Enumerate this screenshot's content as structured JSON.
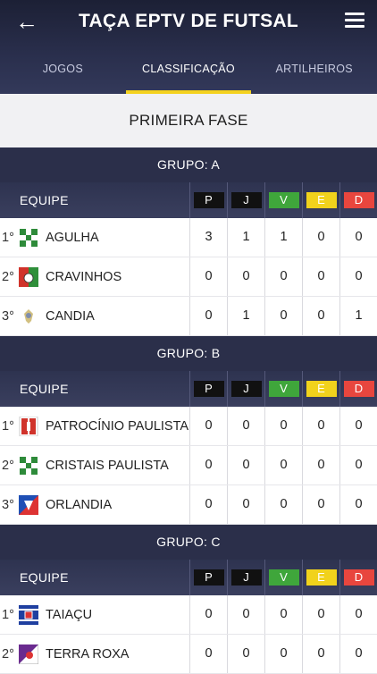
{
  "header": {
    "title": "TAÇA EPTV DE FUTSAL",
    "tabs": [
      {
        "label": "JOGOS",
        "active": false
      },
      {
        "label": "CLASSIFICAÇÃO",
        "active": true
      },
      {
        "label": "ARTILHEIROS",
        "active": false
      }
    ]
  },
  "phase_title": "PRIMEIRA FASE",
  "table_header": {
    "team_label": "EQUIPE",
    "columns": [
      "P",
      "J",
      "V",
      "E",
      "D"
    ]
  },
  "groups": [
    {
      "title": "GRUPO: A",
      "teams": [
        {
          "pos": "1°",
          "name": "AGULHA",
          "crest": "green-cross-crest",
          "P": "3",
          "J": "1",
          "V": "1",
          "E": "0",
          "D": "0"
        },
        {
          "pos": "2°",
          "name": "CRAVINHOS",
          "crest": "red-green-crest",
          "P": "0",
          "J": "0",
          "V": "0",
          "E": "0",
          "D": "0"
        },
        {
          "pos": "3°",
          "name": "CANDIA",
          "crest": "eagle-crest",
          "P": "0",
          "J": "1",
          "V": "0",
          "E": "0",
          "D": "1"
        }
      ]
    },
    {
      "title": "GRUPO: B",
      "teams": [
        {
          "pos": "1°",
          "name": "PATROCÍNIO PAULISTA",
          "crest": "red-white-crest",
          "P": "0",
          "J": "0",
          "V": "0",
          "E": "0",
          "D": "0"
        },
        {
          "pos": "2°",
          "name": "CRISTAIS PAULISTA",
          "crest": "green-cross-crest",
          "P": "0",
          "J": "0",
          "V": "0",
          "E": "0",
          "D": "0"
        },
        {
          "pos": "3°",
          "name": "ORLANDIA",
          "crest": "blue-red-crest",
          "P": "0",
          "J": "0",
          "V": "0",
          "E": "0",
          "D": "0"
        }
      ]
    },
    {
      "title": "GRUPO: C",
      "teams": [
        {
          "pos": "1°",
          "name": "TAIAÇU",
          "crest": "blue-striped-crest",
          "P": "0",
          "J": "0",
          "V": "0",
          "E": "0",
          "D": "0"
        },
        {
          "pos": "2°",
          "name": "TERRA ROXA",
          "crest": "purple-crest",
          "P": "0",
          "J": "0",
          "V": "0",
          "E": "0",
          "D": "0"
        }
      ]
    }
  ],
  "colors": {
    "header_bg": "#2b2f4a",
    "tab_indicator": "#f4d21f",
    "col_V": "#3fa63b",
    "col_E": "#f1d21c",
    "col_D": "#e8463e"
  }
}
